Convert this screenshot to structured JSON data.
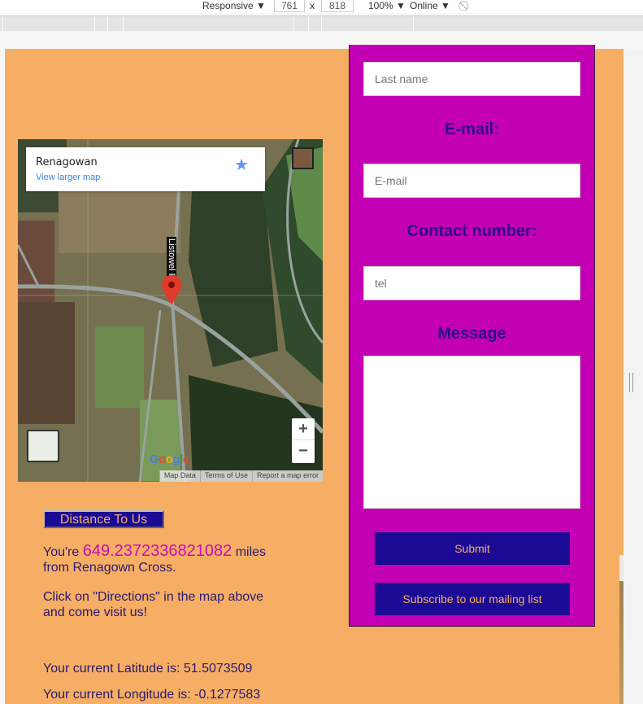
{
  "devtools": {
    "device": "Responsive",
    "width": "761",
    "times": "x",
    "height": "818",
    "zoom": "100%",
    "network": "Online",
    "rotate_icon": "rotate-icon"
  },
  "map": {
    "place_name": "Renagowan",
    "view_larger": "View larger map",
    "road_label": "Listowel Rd",
    "zoom_in": "+",
    "zoom_out": "−",
    "logo": "Google",
    "attribution": [
      "Map Data",
      "Terms of Use",
      "Report a map error"
    ]
  },
  "distance": {
    "button": "Distance To Us",
    "prefix": "You're",
    "value": "649.2372336821082",
    "suffix": "miles",
    "line2": "from Renagown Cross.",
    "directions1": "Click on \"Directions\" in the map above",
    "directions2": "and come visit us!",
    "latitude": "Your current Latitude is: 51.5073509",
    "longitude": "Your current Longitude is: -0.1277583"
  },
  "form": {
    "lastname_placeholder": "Last name",
    "email_label": "E-mail:",
    "email_placeholder": "E-mail",
    "contact_label": "Contact number:",
    "tel_placeholder": "tel",
    "message_label": "Message",
    "submit": "Submit",
    "subscribe": "Subscribe to our mailing list"
  },
  "colors": {
    "page_bg": "#f5ae64",
    "form_bg": "#c400b4",
    "button_bg": "#1a0a94",
    "text": "#2a1a70",
    "highlight": "#c410b5"
  }
}
